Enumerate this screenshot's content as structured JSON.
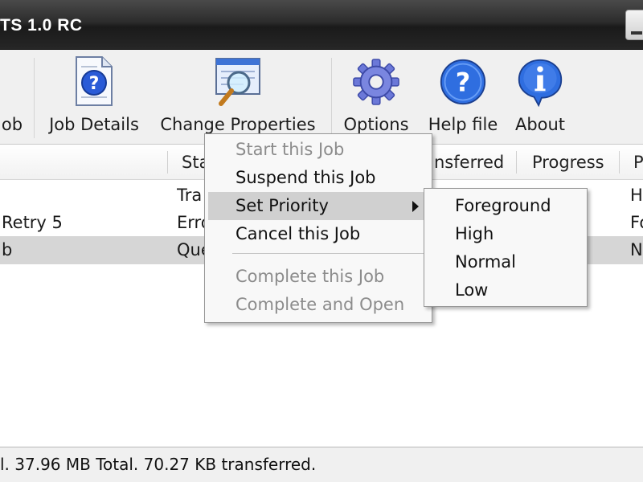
{
  "window": {
    "title": "TS 1.0 RC"
  },
  "toolbar": {
    "partial_label": "ob",
    "job_details": "Job Details",
    "change_properties": "Change Properties",
    "options": "Options",
    "help_file": "Help file",
    "about": "About"
  },
  "columns": {
    "status": "Sta",
    "transferred": "nsferred",
    "progress": "Progress",
    "priority": "P"
  },
  "rows": [
    {
      "name": "",
      "status": "Tra",
      "priority": "Hi"
    },
    {
      "name": "Retry 5",
      "status": "Erro",
      "priority": "Fo"
    },
    {
      "name": "b",
      "status": "Que",
      "priority": "No"
    }
  ],
  "context_menu": {
    "start": "Start this Job",
    "suspend": "Suspend this Job",
    "set_priority": "Set Priority",
    "cancel": "Cancel this Job",
    "complete": "Complete this Job",
    "complete_open": "Complete and Open"
  },
  "priority_menu": {
    "foreground": "Foreground",
    "high": "High",
    "normal": "Normal",
    "low": "Low"
  },
  "status_bar": {
    "text": "l. 37.96 MB Total. 70.27 KB transferred."
  },
  "colors": {
    "titlebar": "#262626",
    "selection": "#d6d6d6",
    "menu_hover": "#d0d0d0",
    "icon_blue": "#2a5bd7"
  }
}
